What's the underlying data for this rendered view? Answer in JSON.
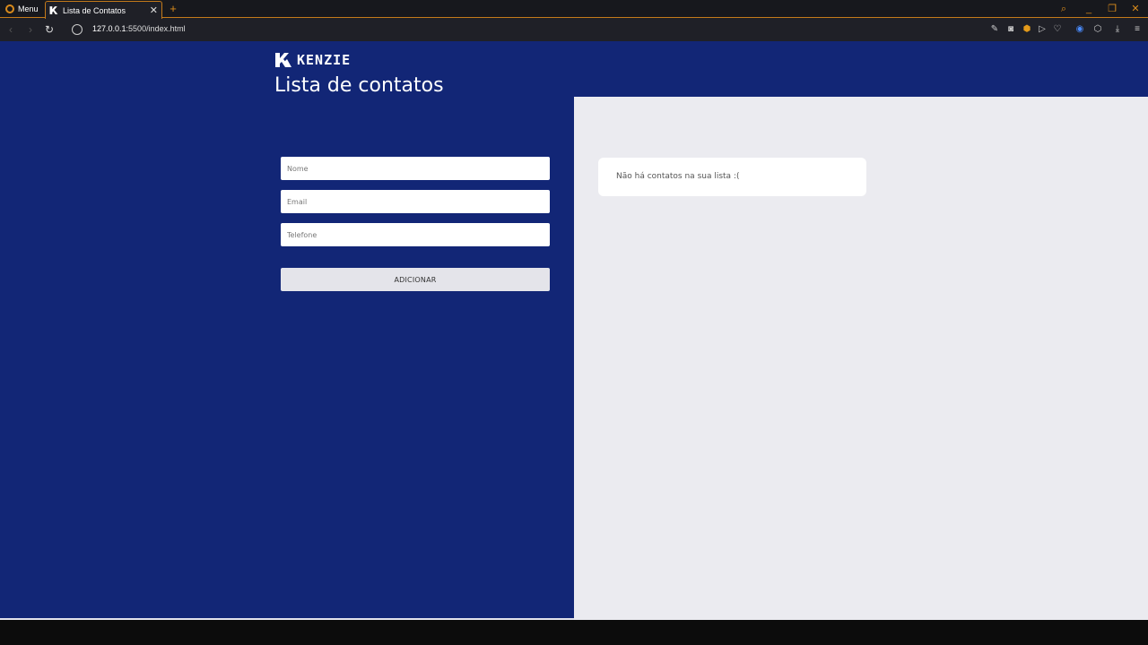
{
  "browser": {
    "menu_label": "Menu",
    "tab_title": "Lista de Contatos",
    "tab_close": "✕",
    "new_tab": "+",
    "url_host": "127.0.0.1",
    "url_rest": ":5500/index.html"
  },
  "header": {
    "brand": "KENZIE",
    "title": "Lista de contatos"
  },
  "form": {
    "name_placeholder": "Nome",
    "email_placeholder": "Email",
    "phone_placeholder": "Telefone",
    "submit_label": "ADICIONAR"
  },
  "contacts": {
    "empty_message": "Não há contatos na sua lista :("
  },
  "colors": {
    "primary": "#122676",
    "panel_bg": "#ebebf0",
    "accent": "#d98b1c"
  }
}
